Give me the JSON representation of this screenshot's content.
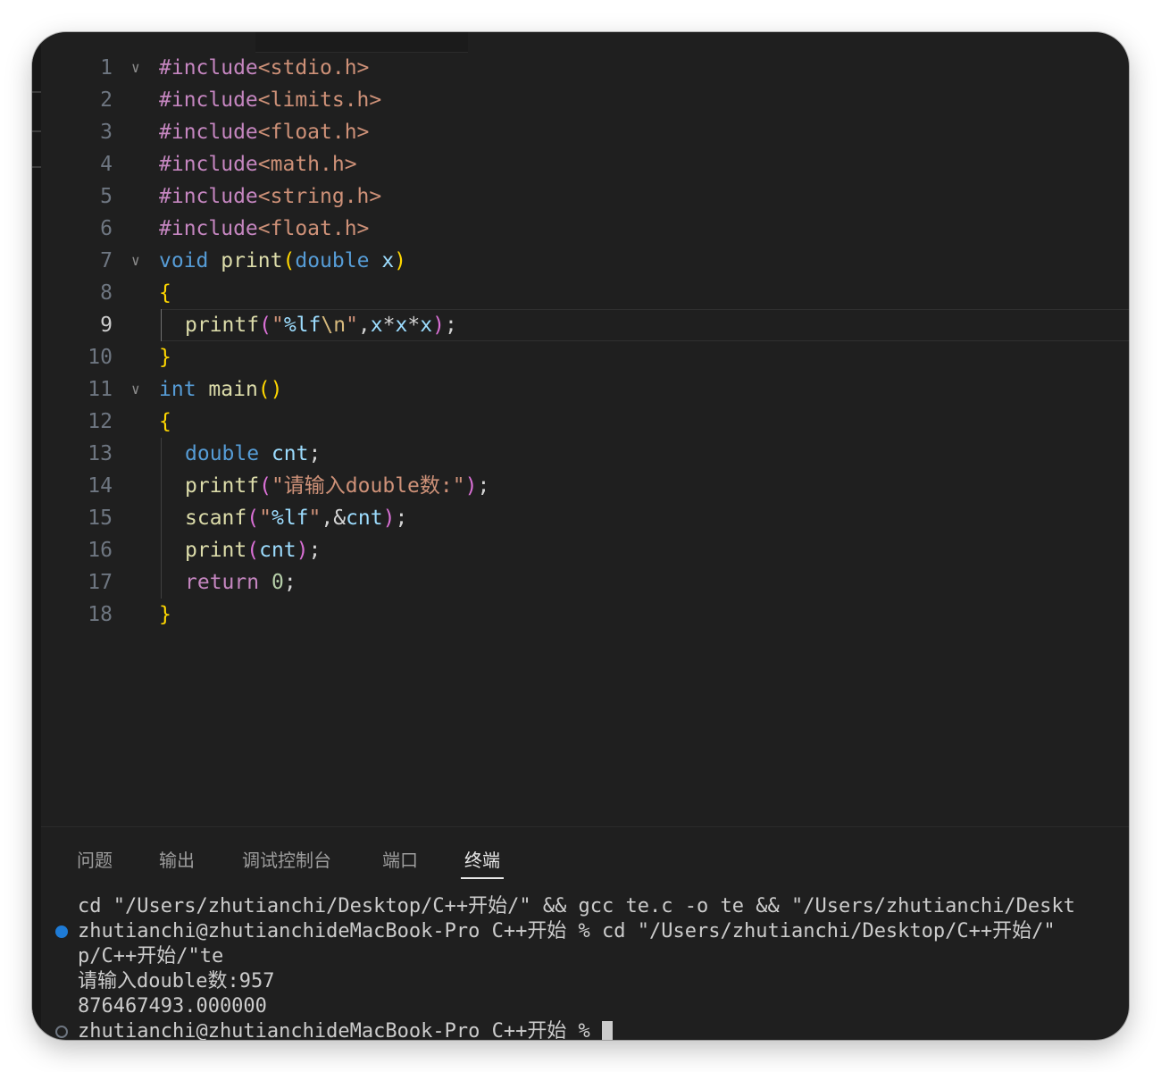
{
  "colors": {
    "editor_bg": "#1f1f1f",
    "keyword_include": "#c586c0",
    "header_string": "#ce9178",
    "type_keyword": "#569cd6",
    "function_name": "#dcdcaa",
    "variable": "#9cdcfe",
    "bracket_gold": "#ffd700",
    "bracket_magenta": "#da70d6",
    "bracket_blue": "#179fff",
    "number": "#b5cea8",
    "terminal_dot": "#1e7bd6"
  },
  "editor": {
    "active_line": 9,
    "lines": [
      {
        "n": "1",
        "fold": true,
        "indent": 0,
        "tokens": [
          [
            "#include",
            "kw-inc"
          ],
          [
            "<stdio.h>",
            "hdr"
          ]
        ]
      },
      {
        "n": "2",
        "fold": false,
        "indent": 0,
        "tokens": [
          [
            "#include",
            "kw-inc"
          ],
          [
            "<limits.h>",
            "hdr"
          ]
        ]
      },
      {
        "n": "3",
        "fold": false,
        "indent": 0,
        "tokens": [
          [
            "#include",
            "kw-inc"
          ],
          [
            "<float.h>",
            "hdr"
          ]
        ]
      },
      {
        "n": "4",
        "fold": false,
        "indent": 0,
        "tokens": [
          [
            "#include",
            "kw-inc"
          ],
          [
            "<math.h>",
            "hdr"
          ]
        ]
      },
      {
        "n": "5",
        "fold": false,
        "indent": 0,
        "tokens": [
          [
            "#include",
            "kw-inc"
          ],
          [
            "<string.h>",
            "hdr"
          ]
        ]
      },
      {
        "n": "6",
        "fold": false,
        "indent": 0,
        "tokens": [
          [
            "#include",
            "kw-inc"
          ],
          [
            "<float.h>",
            "hdr"
          ]
        ]
      },
      {
        "n": "7",
        "fold": true,
        "indent": 0,
        "tokens": [
          [
            "void",
            "type"
          ],
          [
            " ",
            "pl"
          ],
          [
            "print",
            "fn"
          ],
          [
            "(",
            "pa"
          ],
          [
            "double",
            "type"
          ],
          [
            " ",
            "pl"
          ],
          [
            "x",
            "var"
          ],
          [
            ")",
            "pa"
          ]
        ]
      },
      {
        "n": "8",
        "fold": false,
        "indent": 0,
        "tokens": [
          [
            "{",
            "pa"
          ]
        ]
      },
      {
        "n": "9",
        "fold": false,
        "indent": 1,
        "tokens": [
          [
            "printf",
            "fn"
          ],
          [
            "(",
            "pb"
          ],
          [
            "\"",
            "str"
          ],
          [
            "%lf",
            "fmt"
          ],
          [
            "\\n",
            "esc"
          ],
          [
            "\"",
            "str"
          ],
          [
            ",",
            "pl"
          ],
          [
            "x",
            "var"
          ],
          [
            "*",
            "pl"
          ],
          [
            "x",
            "var"
          ],
          [
            "*",
            "pl"
          ],
          [
            "x",
            "var"
          ],
          [
            ")",
            "pb"
          ],
          [
            ";",
            "pl"
          ]
        ]
      },
      {
        "n": "10",
        "fold": false,
        "indent": 0,
        "tokens": [
          [
            "}",
            "pa"
          ]
        ]
      },
      {
        "n": "11",
        "fold": true,
        "indent": 0,
        "tokens": [
          [
            "int",
            "type"
          ],
          [
            " ",
            "pl"
          ],
          [
            "main",
            "fn"
          ],
          [
            "()",
            "pa"
          ]
        ]
      },
      {
        "n": "12",
        "fold": false,
        "indent": 0,
        "tokens": [
          [
            "{",
            "pa"
          ]
        ]
      },
      {
        "n": "13",
        "fold": false,
        "indent": 1,
        "tokens": [
          [
            "double",
            "type"
          ],
          [
            " ",
            "pl"
          ],
          [
            "cnt",
            "var"
          ],
          [
            ";",
            "pl"
          ]
        ]
      },
      {
        "n": "14",
        "fold": false,
        "indent": 1,
        "tokens": [
          [
            "printf",
            "fn"
          ],
          [
            "(",
            "pb"
          ],
          [
            "\"请输入double数:\"",
            "str"
          ],
          [
            ")",
            "pb"
          ],
          [
            ";",
            "pl"
          ]
        ]
      },
      {
        "n": "15",
        "fold": false,
        "indent": 1,
        "tokens": [
          [
            "scanf",
            "fn"
          ],
          [
            "(",
            "pb"
          ],
          [
            "\"",
            "str"
          ],
          [
            "%lf",
            "fmt"
          ],
          [
            "\"",
            "str"
          ],
          [
            ",&",
            "pl"
          ],
          [
            "cnt",
            "var"
          ],
          [
            ")",
            "pb"
          ],
          [
            ";",
            "pl"
          ]
        ]
      },
      {
        "n": "16",
        "fold": false,
        "indent": 1,
        "tokens": [
          [
            "print",
            "fn"
          ],
          [
            "(",
            "pb"
          ],
          [
            "cnt",
            "var"
          ],
          [
            ")",
            "pb"
          ],
          [
            ";",
            "pl"
          ]
        ]
      },
      {
        "n": "17",
        "fold": false,
        "indent": 1,
        "tokens": [
          [
            "return",
            "ret"
          ],
          [
            " ",
            "pl"
          ],
          [
            "0",
            "num"
          ],
          [
            ";",
            "pl"
          ]
        ]
      },
      {
        "n": "18",
        "fold": false,
        "indent": 0,
        "tokens": [
          [
            "}",
            "pa"
          ]
        ]
      }
    ]
  },
  "panel": {
    "tabs": [
      {
        "label": "问题",
        "active": false
      },
      {
        "label": "输出",
        "active": false
      },
      {
        "label": "调试控制台",
        "active": false
      },
      {
        "label": "端口",
        "active": false
      },
      {
        "label": "终端",
        "active": true
      }
    ]
  },
  "terminal": {
    "lines": [
      {
        "dot": "none",
        "text": "cd \"/Users/zhutianchi/Desktop/C++开始/\" && gcc te.c -o te && \"/Users/zhutianchi/Deskt"
      },
      {
        "dot": "blue",
        "text": "zhutianchi@zhutianchideMacBook-Pro C++开始 % cd \"/Users/zhutianchi/Desktop/C++开始/\""
      },
      {
        "dot": "none",
        "text": "p/C++开始/\"te"
      },
      {
        "dot": "none",
        "text": "请输入double数:957"
      },
      {
        "dot": "none",
        "text": "876467493.000000"
      },
      {
        "dot": "hollow",
        "text": "zhutianchi@zhutianchideMacBook-Pro C++开始 % "
      }
    ]
  }
}
